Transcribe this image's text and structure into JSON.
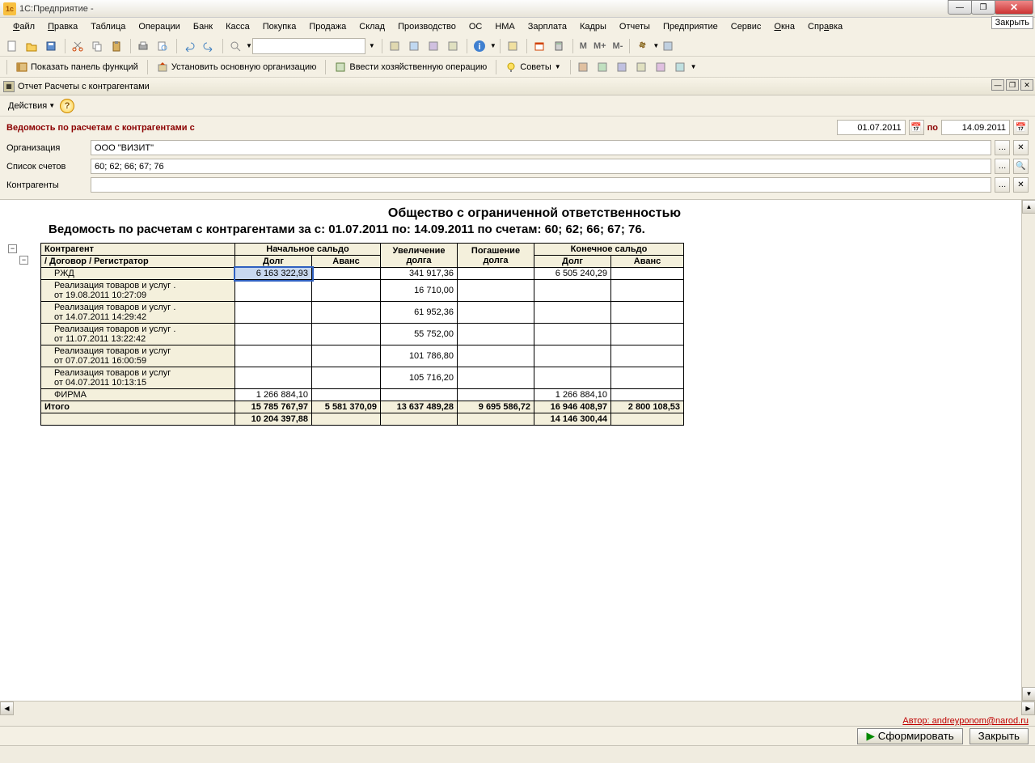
{
  "titlebar": {
    "app": "1С:Предприятие -"
  },
  "close_tooltip": "Закрыть",
  "menubar": [
    "Файл",
    "Правка",
    "Таблица",
    "Операции",
    "Банк",
    "Касса",
    "Покупка",
    "Продажа",
    "Склад",
    "Производство",
    "ОС",
    "НМА",
    "Зарплата",
    "Кадры",
    "Отчеты",
    "Предприятие",
    "Сервис",
    "Окна",
    "Справка"
  ],
  "toolbar_m": {
    "m": "M",
    "mplus": "M+",
    "mminus": "M-"
  },
  "func_toolbar": {
    "panel": "Показать панель функций",
    "org": "Установить основную организацию",
    "oper": "Ввести хозяйственную операцию",
    "advice": "Советы"
  },
  "subwindow_title": "Отчет  Расчеты с контрагентами",
  "actions_label": "Действия",
  "params": {
    "title": "Ведомость по расчетам с контрагентами с",
    "date_from": "01.07.2011",
    "date_sep": "по",
    "date_to": "14.09.2011",
    "org_label": "Организация",
    "org_value": "ООО \"ВИЗИТ\"",
    "accounts_label": "Список счетов",
    "accounts_value": "60; 62; 66; 67; 76",
    "contractors_label": "Контрагенты",
    "contractors_value": ""
  },
  "report": {
    "title": "Общество с ограниченной ответственностью",
    "subtitle": "Ведомость по расчетам с контрагентами за  с: 01.07.2011 по: 14.09.2011 по счетам: 60; 62; 66; 67; 76.",
    "headers": {
      "col1a": "Контрагент",
      "col1b": "/ Договор / Регистратор",
      "start": "Начальное сальдо",
      "inc": "Увеличение долга",
      "dec": "Погашение долга",
      "end": "Конечное сальдо",
      "debt": "Долг",
      "advance": "Аванс"
    },
    "rows": [
      {
        "type": "group",
        "name": "РЖД",
        "start_debt": "6 163 322,93",
        "start_adv": "",
        "inc": "341 917,36",
        "dec": "",
        "end_debt": "6 505 240,29",
        "end_adv": "",
        "hl": true
      },
      {
        "type": "detail",
        "name": "Реализация товаров и услуг .\nот 19.08.2011 10:27:09",
        "start_debt": "",
        "start_adv": "",
        "inc": "16 710,00",
        "dec": "",
        "end_debt": "",
        "end_adv": ""
      },
      {
        "type": "detail",
        "name": "Реализация товаров и услуг .\nот 14.07.2011 14:29:42",
        "start_debt": "",
        "start_adv": "",
        "inc": "61 952,36",
        "dec": "",
        "end_debt": "",
        "end_adv": ""
      },
      {
        "type": "detail",
        "name": "Реализация товаров и услуг .\nот 11.07.2011 13:22:42",
        "start_debt": "",
        "start_adv": "",
        "inc": "55 752,00",
        "dec": "",
        "end_debt": "",
        "end_adv": ""
      },
      {
        "type": "detail",
        "name": "Реализация товаров и услуг\nот 07.07.2011 16:00:59",
        "start_debt": "",
        "start_adv": "",
        "inc": "101 786,80",
        "dec": "",
        "end_debt": "",
        "end_adv": ""
      },
      {
        "type": "detail",
        "name": "Реализация товаров и услуг\nот 04.07.2011 10:13:15",
        "start_debt": "",
        "start_adv": "",
        "inc": "105 716,20",
        "dec": "",
        "end_debt": "",
        "end_adv": ""
      },
      {
        "type": "group",
        "name": "ФИРМА",
        "start_debt": "1 266 884,10",
        "start_adv": "",
        "inc": "",
        "dec": "",
        "end_debt": "1 266 884,10",
        "end_adv": ""
      }
    ],
    "totals": {
      "label": "Итого",
      "r1": {
        "start_debt": "15 785 767,97",
        "start_adv": "5 581 370,09",
        "inc": "13 637 489,28",
        "dec": "9 695 586,72",
        "end_debt": "16 946 408,97",
        "end_adv": "2 800 108,53"
      },
      "r2": {
        "start_debt": "10 204 397,88",
        "end_debt": "14 146 300,44"
      }
    }
  },
  "author": "Автор: andreyponom@narod.ru",
  "buttons": {
    "run": "Сформировать",
    "close": "Закрыть"
  }
}
